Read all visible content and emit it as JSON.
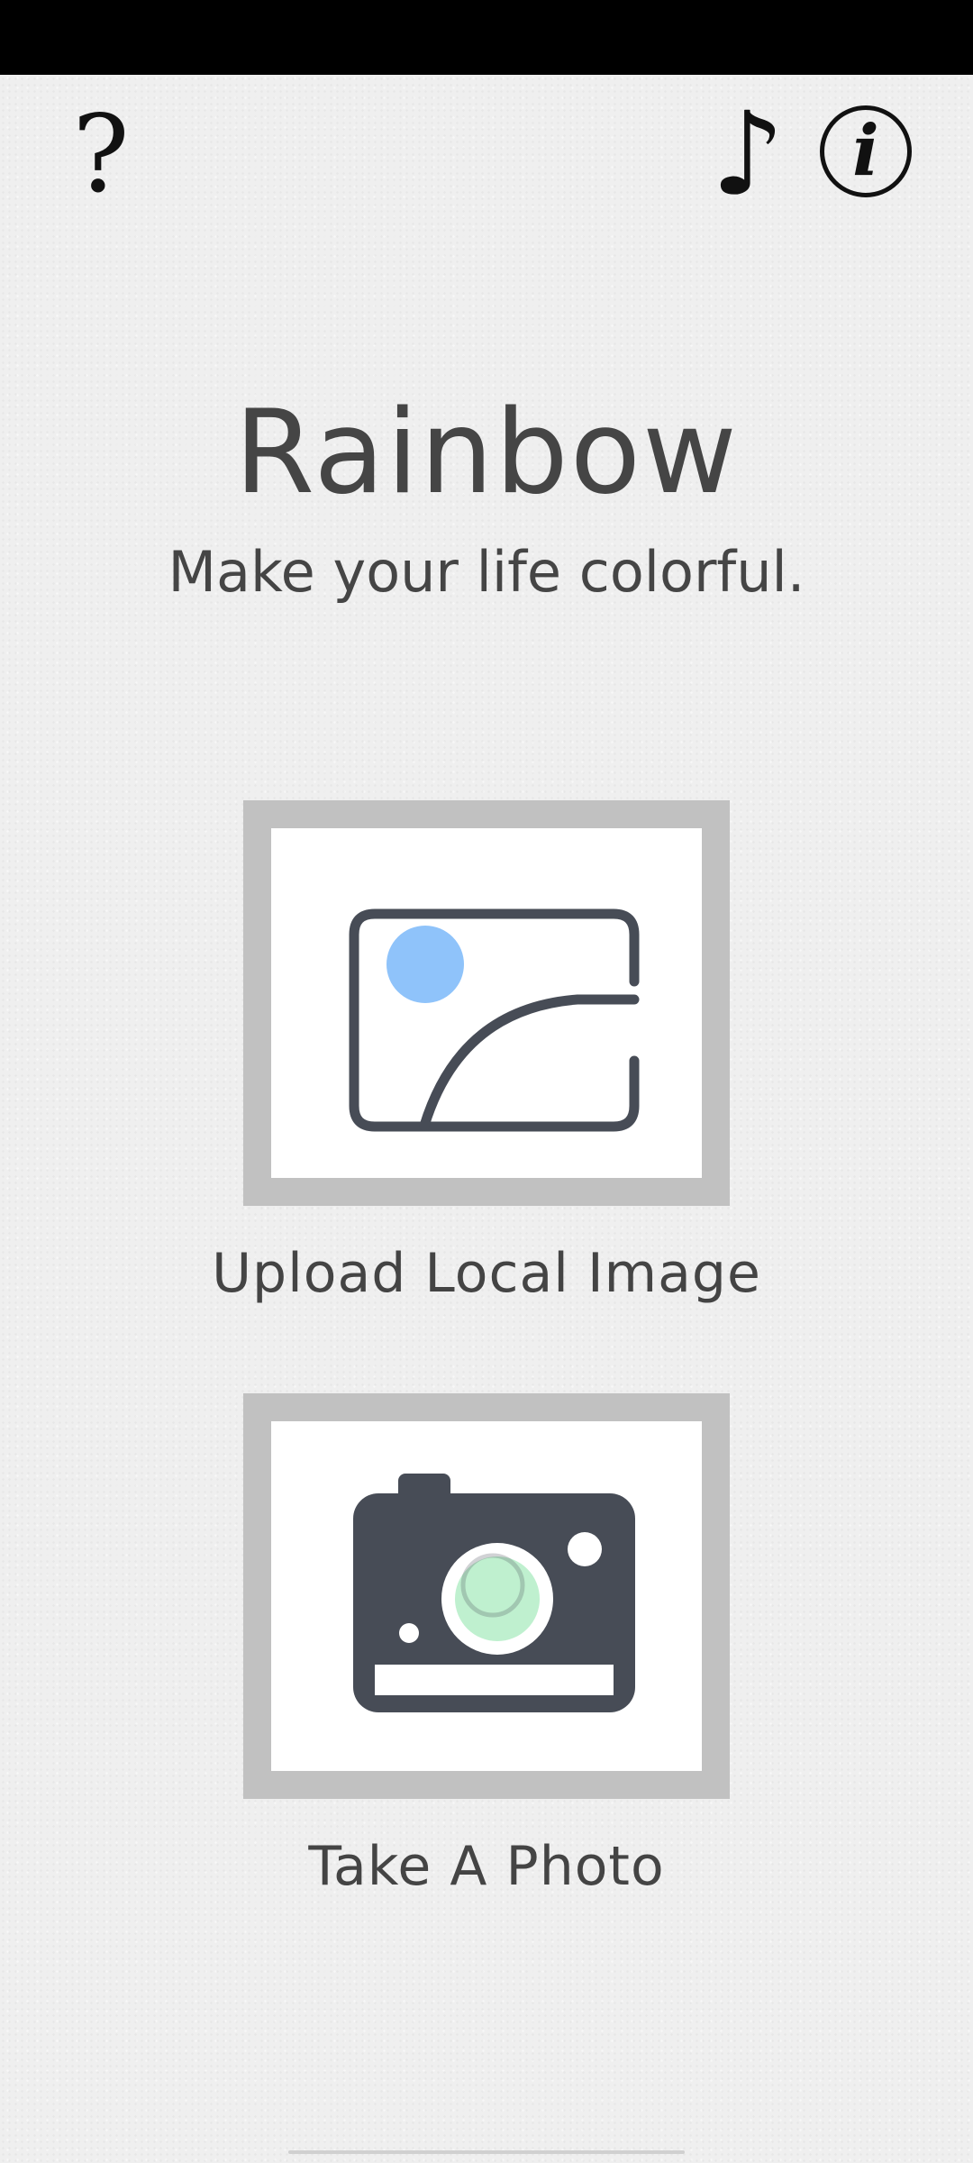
{
  "header": {
    "help_glyph": "?",
    "music_glyph": "♪",
    "info_glyph": "i",
    "icons": [
      "help-icon",
      "music-icon",
      "info-icon"
    ]
  },
  "hero": {
    "title": "Rainbow",
    "subtitle": "Make your life colorful."
  },
  "actions": [
    {
      "label": "Upload Local Image",
      "icon": "image-icon"
    },
    {
      "label": "Take A Photo",
      "icon": "camera-icon"
    }
  ],
  "colors": {
    "background": "#efefef",
    "status_bar": "#000000",
    "text": "#454545",
    "tile_frame": "#c1c1c1",
    "icon_dark": "#474c56",
    "image_sun": "#8fc3fa",
    "camera_lens": "#bff0cf"
  }
}
